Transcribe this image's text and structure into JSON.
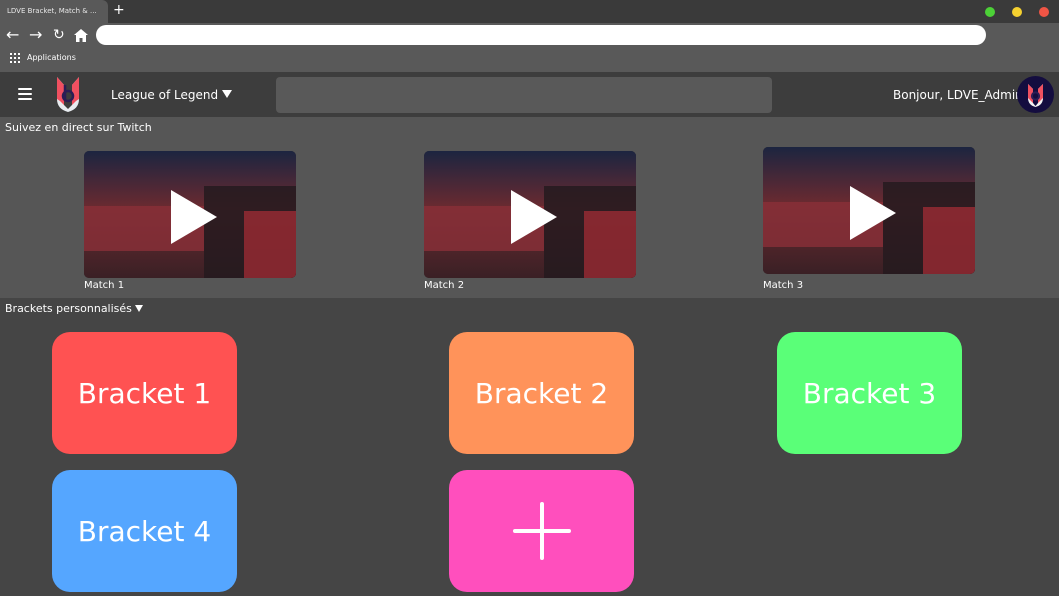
{
  "browser": {
    "tab_title": "LDVE Bracket, Match & ...",
    "new_tab": "+",
    "url": "",
    "bookmarks": {
      "apps_label": "Applications"
    },
    "window_dots": [
      "#4cd137",
      "#f5d130",
      "#f05545"
    ]
  },
  "header": {
    "game_selector": "League of Legend",
    "search_placeholder": "",
    "greeting": "Bonjour, LDVE_Admin"
  },
  "twitch": {
    "title": "Suivez en direct sur Twitch",
    "matches": [
      {
        "label": "Match 1"
      },
      {
        "label": "Match 2"
      },
      {
        "label": "Match 3"
      }
    ]
  },
  "brackets": {
    "title": "Brackets personnalisés",
    "items": [
      {
        "label": "Bracket 1",
        "color": "#ff5252"
      },
      {
        "label": "Bracket 2",
        "color": "#ff935a"
      },
      {
        "label": "Bracket 3",
        "color": "#5aff78"
      },
      {
        "label": "Bracket 4",
        "color": "#55a6ff"
      }
    ],
    "add_color": "#ff4fbd",
    "add_icon": "plus-icon"
  }
}
